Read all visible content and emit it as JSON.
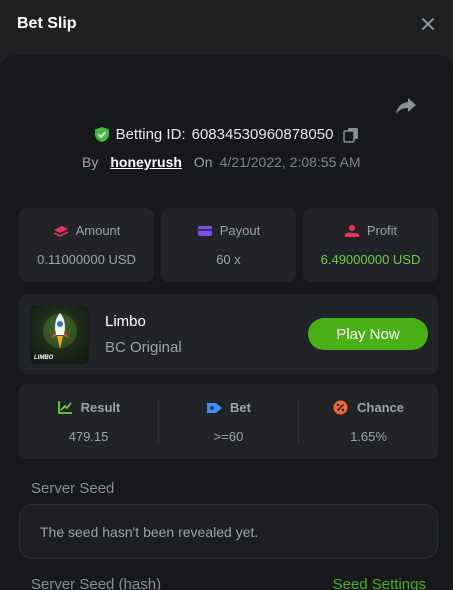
{
  "header": {
    "title": "Bet Slip",
    "close_icon": "close-icon"
  },
  "bet": {
    "id_label": "Betting ID:",
    "id_value": "60834530960878050",
    "by_label": "By",
    "username": "honeyrush",
    "on_label": "On",
    "date": "4/21/2022, 2:08:55 AM"
  },
  "stats": {
    "amount": {
      "label": "Amount",
      "value": "0.11000000 USD",
      "icon": "money-stack-icon"
    },
    "payout": {
      "label": "Payout",
      "value": "60 x",
      "icon": "wallet-card-icon"
    },
    "profit": {
      "label": "Profit",
      "value": "6.49000000 USD",
      "icon": "hand-coin-icon"
    }
  },
  "game": {
    "name": "Limbo",
    "subtitle": "BC Original",
    "thumb_brand": "LIMBO",
    "play_label": "Play Now"
  },
  "result": {
    "result": {
      "label": "Result",
      "value": "479.15"
    },
    "bet": {
      "label": "Bet",
      "value": ">=60"
    },
    "chance": {
      "label": "Chance",
      "value": "1.65%"
    }
  },
  "seed": {
    "server_seed_label": "Server Seed",
    "server_seed_text": "The seed hasn't been revealed yet.",
    "server_seed_hash_label": "Server Seed (hash)",
    "seed_settings_label": "Seed Settings"
  },
  "colors": {
    "accent_green": "#4ab018",
    "profit_green": "#6ccf3e",
    "background": "#1e2022",
    "panel": "#17181b",
    "card": "#212328"
  }
}
